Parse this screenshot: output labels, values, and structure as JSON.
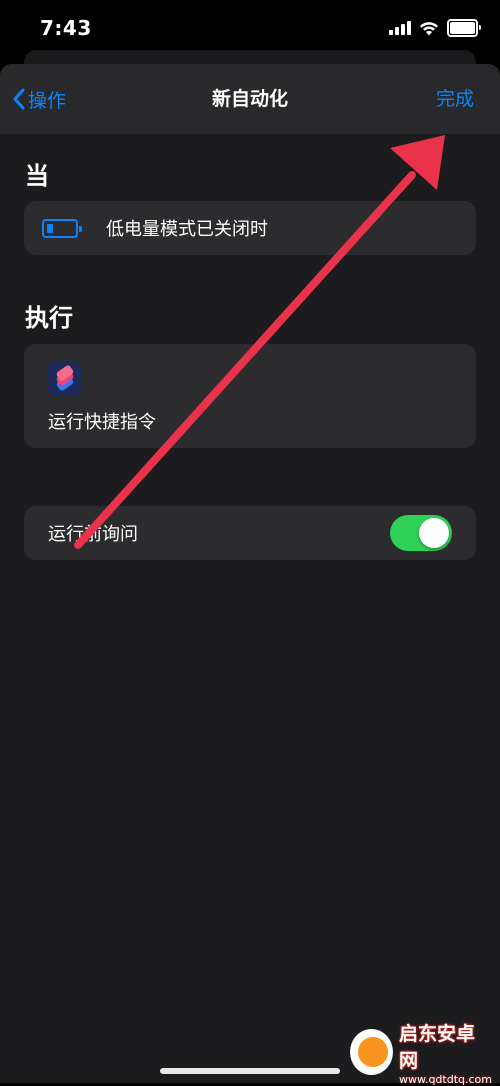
{
  "status_bar": {
    "time": "7:43"
  },
  "nav": {
    "back_label": "操作",
    "title": "新自动化",
    "done_label": "完成"
  },
  "when_section": {
    "heading": "当",
    "trigger": "低电量模式已关闭时"
  },
  "do_section": {
    "heading": "执行",
    "action": "运行快捷指令"
  },
  "ask_before_running": {
    "label": "运行前询问",
    "enabled": true
  },
  "colors": {
    "accent": "#0a84ff",
    "toggle_on": "#30d158",
    "annotation_arrow": "#e8334a"
  },
  "watermark": {
    "brand": "启东安卓网",
    "url": "www.qdtdtq.com"
  }
}
